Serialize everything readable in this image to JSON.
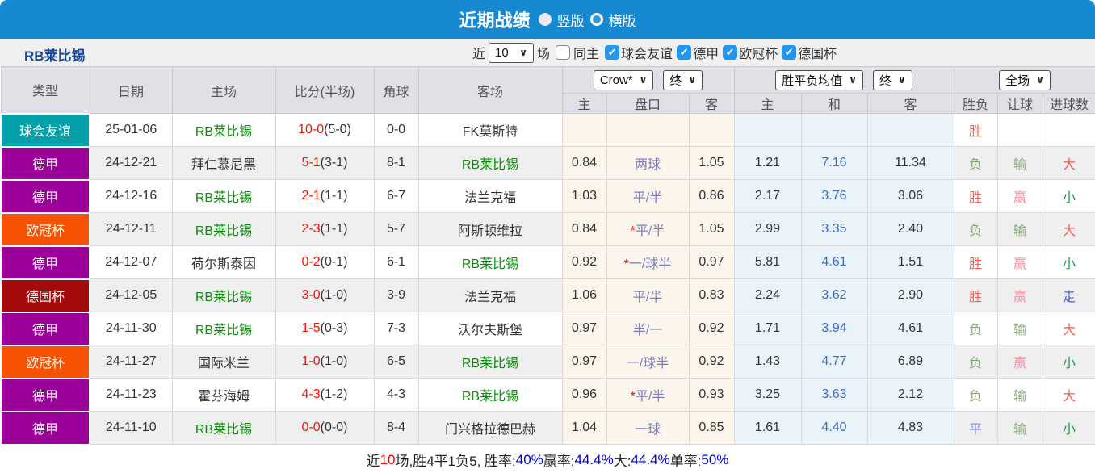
{
  "header": {
    "title": "近期战绩",
    "vertical_label": "竖版",
    "horizontal_label": "横版"
  },
  "filter": {
    "team": "RB莱比锡",
    "near_label": "近",
    "match_count": "10",
    "games_label": "场",
    "same_home_label": "同主",
    "competitions": [
      "球会友谊",
      "德甲",
      "欧冠杯",
      "德国杯"
    ]
  },
  "controls": {
    "crow_select": "Crow*",
    "crow_time_select": "终",
    "avg_select": "胜平负均值",
    "avg_time_select": "终",
    "scope_select": "全场"
  },
  "table": {
    "left_headers": [
      "类型",
      "日期",
      "主场",
      "比分(半场)",
      "角球",
      "客场"
    ],
    "sub_headers": [
      "主",
      "盘口",
      "客",
      "主",
      "和",
      "客",
      "胜负",
      "让球",
      "进球数"
    ],
    "competition_colors": {
      "球会友谊": "#02a0a8",
      "德甲": "#9b0199",
      "欧冠杯": "#f75203",
      "德国杯": "#a40c0c"
    },
    "rows": [
      {
        "type": "球会友谊",
        "date": "25-01-06",
        "home": "RB莱比锡",
        "score": "10-0",
        "half": "(5-0)",
        "corner": "0-0",
        "away": "FK莫斯特",
        "crow_home": "",
        "handicap": "",
        "crow_away": "",
        "avg_home": "",
        "avg_draw": "",
        "avg_away": "",
        "result": "胜",
        "spread": "",
        "goals": ""
      },
      {
        "type": "德甲",
        "date": "24-12-21",
        "home": "拜仁慕尼黑",
        "score": "5-1",
        "half": "(3-1)",
        "corner": "8-1",
        "away": "RB莱比锡",
        "crow_home": "0.84",
        "handicap": "两球",
        "crow_away": "1.05",
        "avg_home": "1.21",
        "avg_draw": "7.16",
        "avg_away": "11.34",
        "result": "负",
        "spread": "输",
        "goals": "大"
      },
      {
        "type": "德甲",
        "date": "24-12-16",
        "home": "RB莱比锡",
        "score": "2-1",
        "half": "(1-1)",
        "corner": "6-7",
        "away": "法兰克福",
        "crow_home": "1.03",
        "handicap": "平/半",
        "crow_away": "0.86",
        "avg_home": "2.17",
        "avg_draw": "3.76",
        "avg_away": "3.06",
        "result": "胜",
        "spread": "赢",
        "goals": "小"
      },
      {
        "type": "欧冠杯",
        "date": "24-12-11",
        "home": "RB莱比锡",
        "score": "2-3",
        "half": "(1-1)",
        "corner": "5-7",
        "away": "阿斯顿维拉",
        "crow_home": "0.84",
        "handicap": "*平/半",
        "crow_away": "1.05",
        "avg_home": "2.99",
        "avg_draw": "3.35",
        "avg_away": "2.40",
        "result": "负",
        "spread": "输",
        "goals": "大"
      },
      {
        "type": "德甲",
        "date": "24-12-07",
        "home": "荷尔斯泰因",
        "score": "0-2",
        "half": "(0-1)",
        "corner": "6-1",
        "away": "RB莱比锡",
        "crow_home": "0.92",
        "handicap": "*一/球半",
        "crow_away": "0.97",
        "avg_home": "5.81",
        "avg_draw": "4.61",
        "avg_away": "1.51",
        "result": "胜",
        "spread": "赢",
        "goals": "小"
      },
      {
        "type": "德国杯",
        "date": "24-12-05",
        "home": "RB莱比锡",
        "score": "3-0",
        "half": "(1-0)",
        "corner": "3-9",
        "away": "法兰克福",
        "crow_home": "1.06",
        "handicap": "平/半",
        "crow_away": "0.83",
        "avg_home": "2.24",
        "avg_draw": "3.62",
        "avg_away": "2.90",
        "result": "胜",
        "spread": "赢",
        "goals": "走"
      },
      {
        "type": "德甲",
        "date": "24-11-30",
        "home": "RB莱比锡",
        "score": "1-5",
        "half": "(0-3)",
        "corner": "7-3",
        "away": "沃尔夫斯堡",
        "crow_home": "0.97",
        "handicap": "半/一",
        "crow_away": "0.92",
        "avg_home": "1.71",
        "avg_draw": "3.94",
        "avg_away": "4.61",
        "result": "负",
        "spread": "输",
        "goals": "大"
      },
      {
        "type": "欧冠杯",
        "date": "24-11-27",
        "home": "国际米兰",
        "score": "1-0",
        "half": "(1-0)",
        "corner": "6-5",
        "away": "RB莱比锡",
        "crow_home": "0.97",
        "handicap": "一/球半",
        "crow_away": "0.92",
        "avg_home": "1.43",
        "avg_draw": "4.77",
        "avg_away": "6.89",
        "result": "负",
        "spread": "赢",
        "goals": "小"
      },
      {
        "type": "德甲",
        "date": "24-11-23",
        "home": "霍芬海姆",
        "score": "4-3",
        "half": "(1-2)",
        "corner": "4-3",
        "away": "RB莱比锡",
        "crow_home": "0.96",
        "handicap": "*平/半",
        "crow_away": "0.93",
        "avg_home": "3.25",
        "avg_draw": "3.63",
        "avg_away": "2.12",
        "result": "负",
        "spread": "输",
        "goals": "大"
      },
      {
        "type": "德甲",
        "date": "24-11-10",
        "home": "RB莱比锡",
        "score": "0-0",
        "half": "(0-0)",
        "corner": "8-4",
        "away": "门兴格拉德巴赫",
        "crow_home": "1.04",
        "handicap": "一球",
        "crow_away": "0.85",
        "avg_home": "1.61",
        "avg_draw": "4.40",
        "avg_away": "4.83",
        "result": "平",
        "spread": "输",
        "goals": "小"
      }
    ]
  },
  "footer_segments": [
    {
      "text": "近",
      "color": "black"
    },
    {
      "text": "10",
      "color": "red"
    },
    {
      "text": "场,胜4平1负5, 胜率:",
      "color": "black"
    },
    {
      "text": "40%",
      "color": "blue"
    },
    {
      "text": " 赢率:",
      "color": "black"
    },
    {
      "text": "44.4%",
      "color": "blue"
    },
    {
      "text": " 大:",
      "color": "black"
    },
    {
      "text": "44.4%",
      "color": "blue"
    },
    {
      "text": " 单率:",
      "color": "black"
    },
    {
      "text": "50%",
      "color": "blue"
    }
  ],
  "colors": {
    "topbar": "#1788d2",
    "checkbox": "#2196f3",
    "team_green": "#089008",
    "score_red": "#fb1000"
  }
}
